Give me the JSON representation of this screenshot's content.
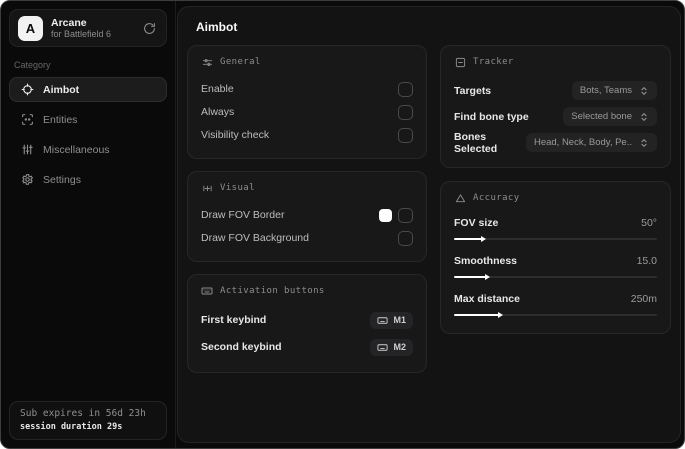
{
  "sidebar": {
    "logo": {
      "letter": "A",
      "title": "Arcane",
      "subtitle": "for Battlefield 6"
    },
    "category_label": "Category",
    "items": [
      {
        "label": "Aimbot",
        "icon": "crosshair-icon",
        "selected": true
      },
      {
        "label": "Entities",
        "icon": "scan-icon",
        "selected": false
      },
      {
        "label": "Miscellaneous",
        "icon": "sliders-vertical-icon",
        "selected": false
      },
      {
        "label": "Settings",
        "icon": "gear-icon",
        "selected": false
      }
    ],
    "footer": {
      "line1": "Sub expires in 56d 23h",
      "line2": "session duration 29s"
    }
  },
  "main": {
    "title": "Aimbot",
    "general": {
      "title": "General",
      "rows": [
        {
          "label": "Enable",
          "checked": false
        },
        {
          "label": "Always",
          "checked": false
        },
        {
          "label": "Visibility check",
          "checked": false
        }
      ]
    },
    "visual": {
      "title": "Visual",
      "rows": [
        {
          "label": "Draw FOV Border",
          "swatch_color": "#ffffff",
          "checked": false
        },
        {
          "label": "Draw FOV Background",
          "checked": false
        }
      ]
    },
    "activation": {
      "title": "Activation buttons",
      "rows": [
        {
          "label": "First keybind",
          "key": "M1"
        },
        {
          "label": "Second keybind",
          "key": "M2"
        }
      ]
    },
    "tracker": {
      "title": "Tracker",
      "rows": [
        {
          "label": "Targets",
          "value": "Bots, Teams"
        },
        {
          "label": "Find bone type",
          "value": "Selected bone"
        },
        {
          "label": "Bones Selected",
          "value": "Head, Neck, Body, Pe.."
        }
      ]
    },
    "accuracy": {
      "title": "Accuracy",
      "rows": [
        {
          "label": "FOV size",
          "value": "50°",
          "fill_pct": 14
        },
        {
          "label": "Smoothness",
          "value": "15.0",
          "fill_pct": 16
        },
        {
          "label": "Max distance",
          "value": "250m",
          "fill_pct": 22
        }
      ]
    }
  },
  "colors": {
    "background": "#131313",
    "card": "#181818",
    "accent_text": "#ffffff"
  }
}
